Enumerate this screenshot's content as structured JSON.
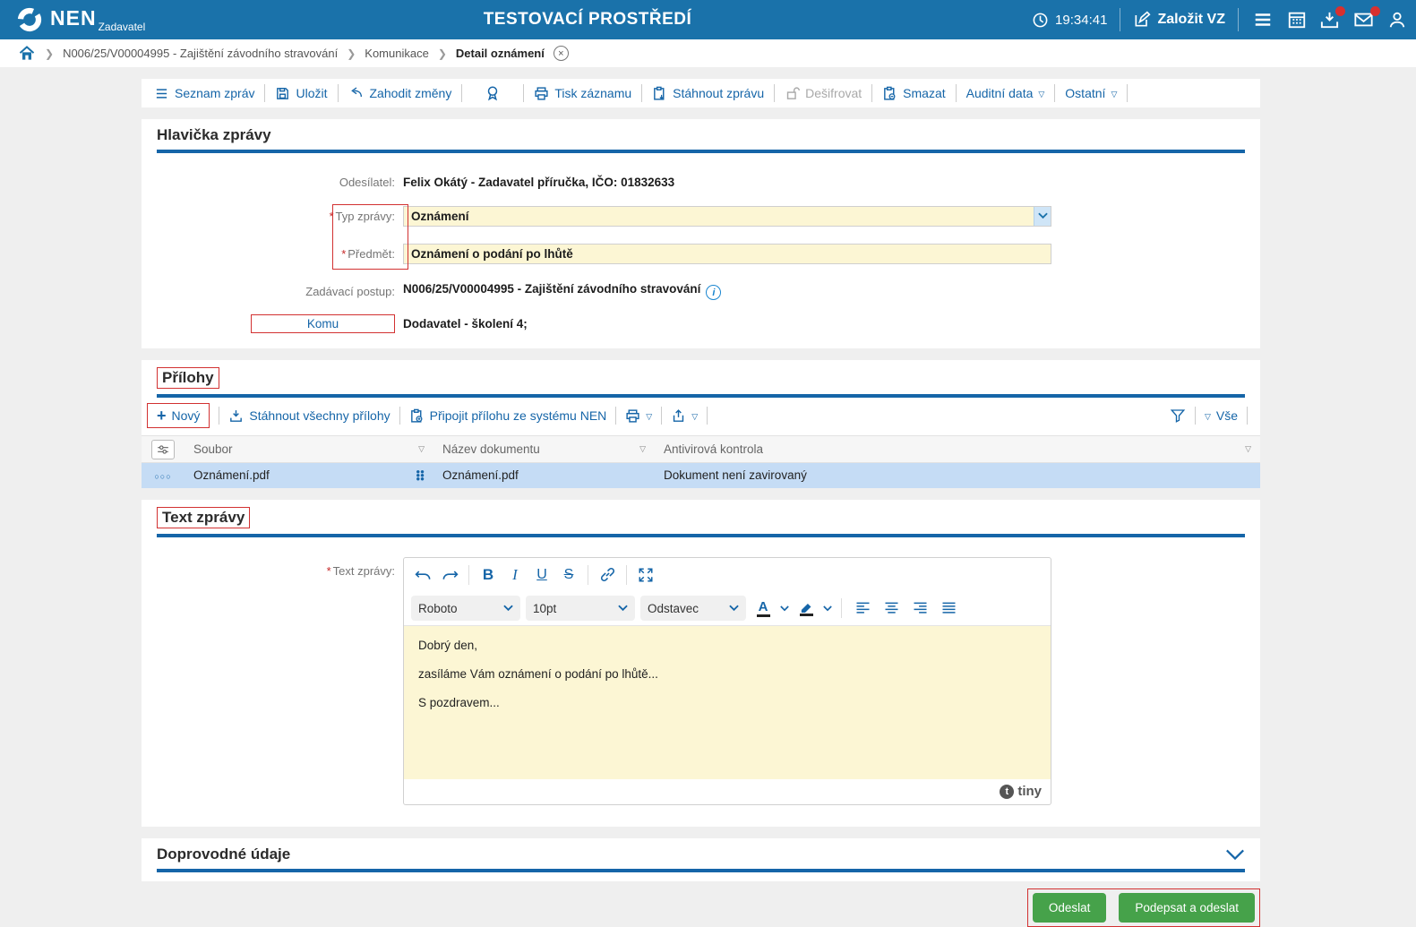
{
  "header": {
    "logo": "NEN",
    "logo_sub": "Zadavatel",
    "title": "TESTOVACÍ PROSTŘEDÍ",
    "time": "19:34:41",
    "create_vz": "Založit VZ"
  },
  "breadcrumb": {
    "items": [
      "N006/25/V00004995 - Zajištění závodního stravování",
      "Komunikace",
      "Detail oznámení"
    ]
  },
  "toolbar": {
    "items": [
      "Seznam zpráv",
      "Uložit",
      "Zahodit změny",
      "Tisk záznamu",
      "Stáhnout zprávu",
      "Dešifrovat",
      "Smazat",
      "Auditní data",
      "Ostatní"
    ]
  },
  "message_header": {
    "title": "Hlavička zprávy",
    "required_marker": "*",
    "sender_label": "Odesílatel:",
    "sender_value": "Felix Okátý - Zadavatel příručka, IČO: 01832633",
    "type_label": "Typ zprávy:",
    "type_value": "Oznámení",
    "subject_label": "Předmět:",
    "subject_value": "Oznámení o podání po lhůtě",
    "procedure_label": "Zadávací postup:",
    "procedure_value": "N006/25/V00004995 - Zajištění závodního stravování",
    "to_label": "Komu",
    "to_value": "Dodavatel - školení 4;"
  },
  "attachments": {
    "title": "Přílohy",
    "toolbar": {
      "new": "Nový",
      "download_all": "Stáhnout všechny přílohy",
      "attach_nen": "Připojit přílohu ze systému NEN",
      "filter_all": "Vše"
    },
    "table": {
      "columns": [
        "Soubor",
        "Název dokumentu",
        "Antivirová kontrola"
      ],
      "rows": [
        {
          "file": "Oznámení.pdf",
          "doc_name": "Oznámení.pdf",
          "antivirus": "Dokument není zavirovaný"
        }
      ]
    }
  },
  "message_text": {
    "title": "Text zprávy",
    "label": "Text zprávy:",
    "editor": {
      "font": "Roboto",
      "size": "10pt",
      "block": "Odstavec",
      "lines": [
        "Dobrý den,",
        "zasíláme Vám oznámení o podání po lhůtě...",
        "S pozdravem..."
      ],
      "brand": "tiny",
      "brand_initial": "t"
    }
  },
  "additional": {
    "title": "Doprovodné údaje"
  },
  "actions": {
    "send": "Odeslat",
    "sign_send": "Podepsat a odeslat"
  },
  "icons": {
    "triangle_down": "▽",
    "chevron": "∨",
    "plus": "+",
    "close": "×",
    "dots3": "●●●",
    "breadcrumb_sep": "❯"
  },
  "colors": {
    "header_blue": "#1a72aa",
    "accent_blue": "#1565a8",
    "input_yellow": "#fcf6d4",
    "selected_row": "#c5dcf5",
    "button_green": "#46a24a",
    "red_box": "#d23131",
    "badge_red": "#d8302f"
  }
}
